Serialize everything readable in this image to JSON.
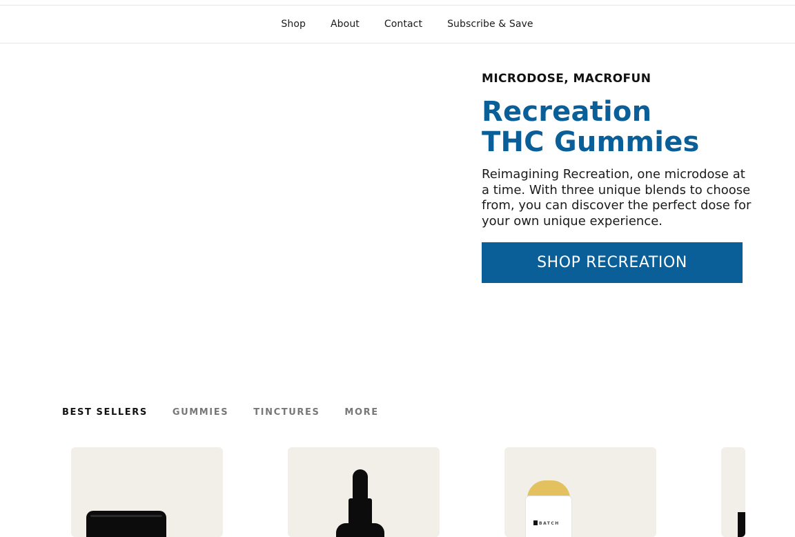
{
  "nav": {
    "items": [
      "Shop",
      "About",
      "Contact",
      "Subscribe & Save"
    ]
  },
  "hero": {
    "eyebrow": "MICRODOSE, MACROFUN",
    "title_line1": "Recreation",
    "title_line2": "THC Gummies",
    "description": "Reimagining Recreation, one microdose at a time. With three unique blends to choose from, you can discover the perfect dose for your own unique experience.",
    "cta_label": "SHOP RECREATION"
  },
  "tabs": [
    {
      "label": "BEST SELLERS",
      "active": true
    },
    {
      "label": "GUMMIES",
      "active": false
    },
    {
      "label": "TINCTURES",
      "active": false
    },
    {
      "label": "MORE",
      "active": false
    }
  ],
  "products": {
    "stick_brand": "BATCH"
  },
  "colors": {
    "brand_blue": "#0b5f99",
    "card_bg": "#f2efe9",
    "stick_cap": "#e3c15f"
  }
}
